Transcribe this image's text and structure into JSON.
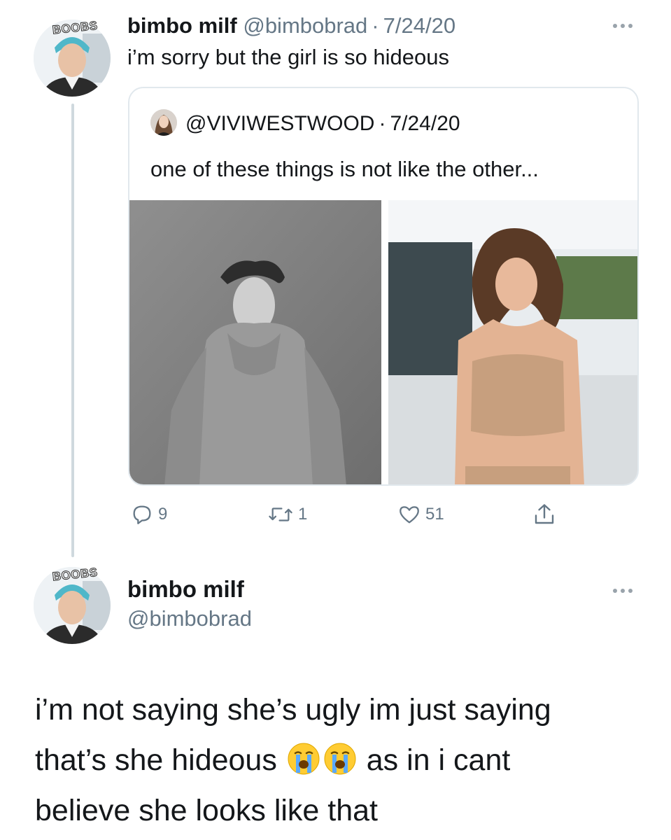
{
  "tweet1": {
    "avatar_badge": "BOOBS",
    "display_name": "bimbo milf",
    "handle": "@bimbobrad",
    "separator": "·",
    "date": "7/24/20",
    "text": "i’m sorry but the girl is so hideous",
    "more_icon": "ellipsis-icon"
  },
  "quote": {
    "handle": "@VIVIWESTWOOD",
    "separator": "·",
    "date": "7/24/20",
    "text": "one of these things is not like the other...",
    "photos": [
      "man-in-gray-hoodie-photo",
      "woman-in-tan-outfit-photo"
    ]
  },
  "actions": {
    "reply_count": "9",
    "retweet_count": "1",
    "like_count": "51",
    "icons": [
      "reply-icon",
      "retweet-icon",
      "like-icon",
      "share-icon"
    ]
  },
  "tweet2": {
    "avatar_badge": "BOOBS",
    "display_name": "bimbo milf",
    "handle": "@bimbobrad",
    "text_line1": "i’m not saying she’s ugly im just saying",
    "text_line2_a": "that’s she hideous",
    "text_line2_b": "as in i cant",
    "text_line3": "believe she looks like that",
    "emoji": "loudly-crying-face-icon"
  },
  "colors": {
    "text": "#14171a",
    "muted": "#657786",
    "border": "#e1e8ed",
    "thread_line": "#cfd9de"
  }
}
